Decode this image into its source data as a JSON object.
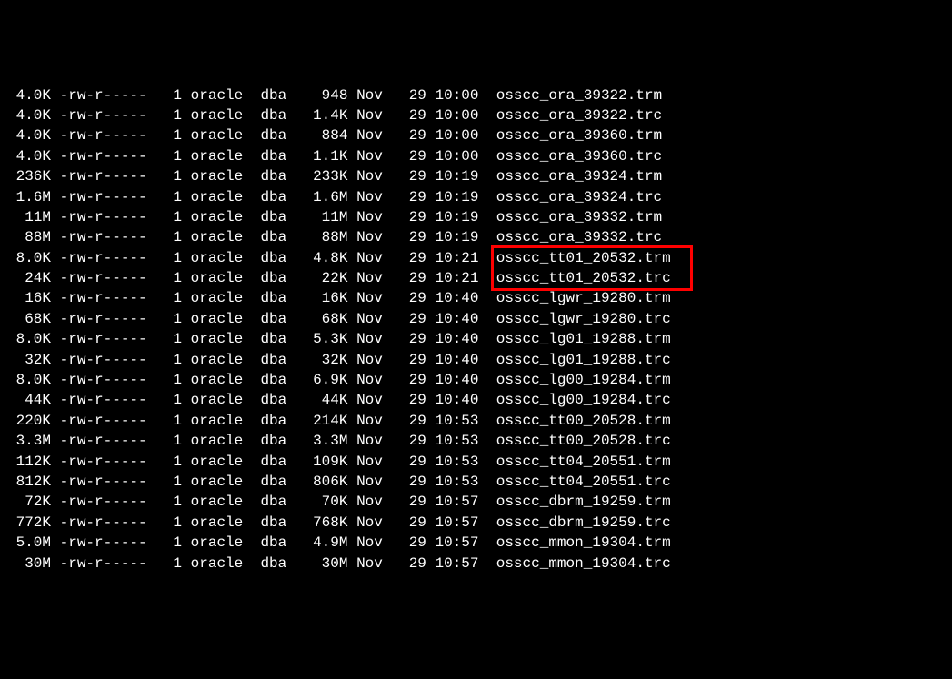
{
  "listing": [
    {
      "blocks": "4.0K",
      "perms": "-rw-r-----",
      "links": "1",
      "owner": "oracle",
      "group": "dba",
      "size": "948",
      "month": "Nov",
      "day": "29",
      "time": "10:00",
      "filename": "osscc_ora_39322.trm"
    },
    {
      "blocks": "4.0K",
      "perms": "-rw-r-----",
      "links": "1",
      "owner": "oracle",
      "group": "dba",
      "size": "1.4K",
      "month": "Nov",
      "day": "29",
      "time": "10:00",
      "filename": "osscc_ora_39322.trc"
    },
    {
      "blocks": "4.0K",
      "perms": "-rw-r-----",
      "links": "1",
      "owner": "oracle",
      "group": "dba",
      "size": "884",
      "month": "Nov",
      "day": "29",
      "time": "10:00",
      "filename": "osscc_ora_39360.trm"
    },
    {
      "blocks": "4.0K",
      "perms": "-rw-r-----",
      "links": "1",
      "owner": "oracle",
      "group": "dba",
      "size": "1.1K",
      "month": "Nov",
      "day": "29",
      "time": "10:00",
      "filename": "osscc_ora_39360.trc"
    },
    {
      "blocks": "236K",
      "perms": "-rw-r-----",
      "links": "1",
      "owner": "oracle",
      "group": "dba",
      "size": "233K",
      "month": "Nov",
      "day": "29",
      "time": "10:19",
      "filename": "osscc_ora_39324.trm"
    },
    {
      "blocks": "1.6M",
      "perms": "-rw-r-----",
      "links": "1",
      "owner": "oracle",
      "group": "dba",
      "size": "1.6M",
      "month": "Nov",
      "day": "29",
      "time": "10:19",
      "filename": "osscc_ora_39324.trc"
    },
    {
      "blocks": "11M",
      "perms": "-rw-r-----",
      "links": "1",
      "owner": "oracle",
      "group": "dba",
      "size": "11M",
      "month": "Nov",
      "day": "29",
      "time": "10:19",
      "filename": "osscc_ora_39332.trm"
    },
    {
      "blocks": "88M",
      "perms": "-rw-r-----",
      "links": "1",
      "owner": "oracle",
      "group": "dba",
      "size": "88M",
      "month": "Nov",
      "day": "29",
      "time": "10:19",
      "filename": "osscc_ora_39332.trc"
    },
    {
      "blocks": "8.0K",
      "perms": "-rw-r-----",
      "links": "1",
      "owner": "oracle",
      "group": "dba",
      "size": "4.8K",
      "month": "Nov",
      "day": "29",
      "time": "10:21",
      "filename": "osscc_tt01_20532.trm"
    },
    {
      "blocks": "24K",
      "perms": "-rw-r-----",
      "links": "1",
      "owner": "oracle",
      "group": "dba",
      "size": "22K",
      "month": "Nov",
      "day": "29",
      "time": "10:21",
      "filename": "osscc_tt01_20532.trc"
    },
    {
      "blocks": "16K",
      "perms": "-rw-r-----",
      "links": "1",
      "owner": "oracle",
      "group": "dba",
      "size": "16K",
      "month": "Nov",
      "day": "29",
      "time": "10:40",
      "filename": "osscc_lgwr_19280.trm"
    },
    {
      "blocks": "68K",
      "perms": "-rw-r-----",
      "links": "1",
      "owner": "oracle",
      "group": "dba",
      "size": "68K",
      "month": "Nov",
      "day": "29",
      "time": "10:40",
      "filename": "osscc_lgwr_19280.trc"
    },
    {
      "blocks": "8.0K",
      "perms": "-rw-r-----",
      "links": "1",
      "owner": "oracle",
      "group": "dba",
      "size": "5.3K",
      "month": "Nov",
      "day": "29",
      "time": "10:40",
      "filename": "osscc_lg01_19288.trm"
    },
    {
      "blocks": "32K",
      "perms": "-rw-r-----",
      "links": "1",
      "owner": "oracle",
      "group": "dba",
      "size": "32K",
      "month": "Nov",
      "day": "29",
      "time": "10:40",
      "filename": "osscc_lg01_19288.trc"
    },
    {
      "blocks": "8.0K",
      "perms": "-rw-r-----",
      "links": "1",
      "owner": "oracle",
      "group": "dba",
      "size": "6.9K",
      "month": "Nov",
      "day": "29",
      "time": "10:40",
      "filename": "osscc_lg00_19284.trm"
    },
    {
      "blocks": "44K",
      "perms": "-rw-r-----",
      "links": "1",
      "owner": "oracle",
      "group": "dba",
      "size": "44K",
      "month": "Nov",
      "day": "29",
      "time": "10:40",
      "filename": "osscc_lg00_19284.trc"
    },
    {
      "blocks": "220K",
      "perms": "-rw-r-----",
      "links": "1",
      "owner": "oracle",
      "group": "dba",
      "size": "214K",
      "month": "Nov",
      "day": "29",
      "time": "10:53",
      "filename": "osscc_tt00_20528.trm"
    },
    {
      "blocks": "3.3M",
      "perms": "-rw-r-----",
      "links": "1",
      "owner": "oracle",
      "group": "dba",
      "size": "3.3M",
      "month": "Nov",
      "day": "29",
      "time": "10:53",
      "filename": "osscc_tt00_20528.trc"
    },
    {
      "blocks": "112K",
      "perms": "-rw-r-----",
      "links": "1",
      "owner": "oracle",
      "group": "dba",
      "size": "109K",
      "month": "Nov",
      "day": "29",
      "time": "10:53",
      "filename": "osscc_tt04_20551.trm"
    },
    {
      "blocks": "812K",
      "perms": "-rw-r-----",
      "links": "1",
      "owner": "oracle",
      "group": "dba",
      "size": "806K",
      "month": "Nov",
      "day": "29",
      "time": "10:53",
      "filename": "osscc_tt04_20551.trc"
    },
    {
      "blocks": "72K",
      "perms": "-rw-r-----",
      "links": "1",
      "owner": "oracle",
      "group": "dba",
      "size": "70K",
      "month": "Nov",
      "day": "29",
      "time": "10:57",
      "filename": "osscc_dbrm_19259.trm"
    },
    {
      "blocks": "772K",
      "perms": "-rw-r-----",
      "links": "1",
      "owner": "oracle",
      "group": "dba",
      "size": "768K",
      "month": "Nov",
      "day": "29",
      "time": "10:57",
      "filename": "osscc_dbrm_19259.trc"
    },
    {
      "blocks": "5.0M",
      "perms": "-rw-r-----",
      "links": "1",
      "owner": "oracle",
      "group": "dba",
      "size": "4.9M",
      "month": "Nov",
      "day": "29",
      "time": "10:57",
      "filename": "osscc_mmon_19304.trm"
    },
    {
      "blocks": "30M",
      "perms": "-rw-r-----",
      "links": "1",
      "owner": "oracle",
      "group": "dba",
      "size": "30M",
      "month": "Nov",
      "day": "29",
      "time": "10:57",
      "filename": "osscc_mmon_19304.trc"
    }
  ],
  "highlight": {
    "rows_start": 8,
    "rows_end": 9,
    "column": "filename"
  }
}
